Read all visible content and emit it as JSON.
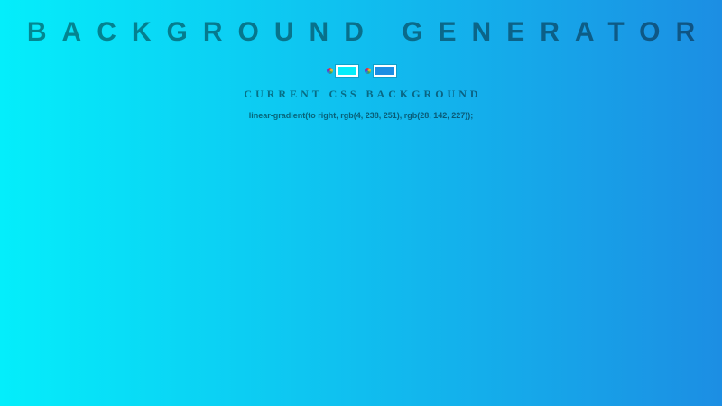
{
  "header": {
    "title": "BACKGROUND GENERATOR"
  },
  "pickers": [
    {
      "icon": "color-wheel-icon",
      "value": "#04eefb",
      "color": "#04eefb"
    },
    {
      "icon": "color-wheel-icon",
      "value": "#1c8ee3",
      "color": "#1c8ee3"
    }
  ],
  "output": {
    "heading": "CURRENT CSS BACKGROUND",
    "css": "linear-gradient(to right, rgb(4, 238, 251), rgb(28, 142, 227));"
  },
  "colors": {
    "gradient_start": "#04eefb",
    "gradient_end": "#1c8ee3"
  }
}
